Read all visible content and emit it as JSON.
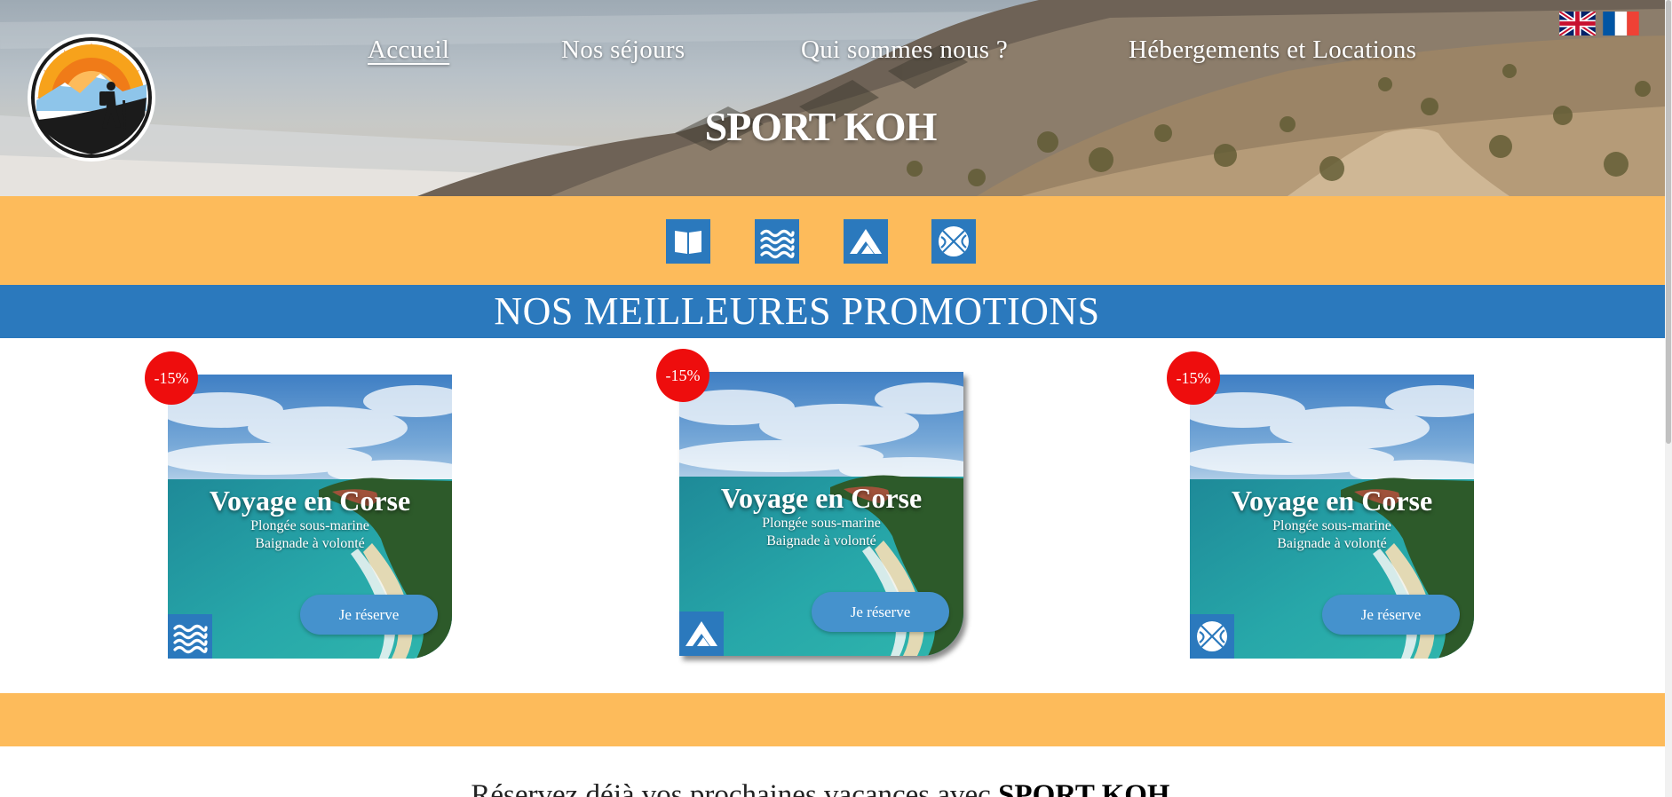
{
  "header": {
    "nav": [
      {
        "label": "Accueil",
        "active": true
      },
      {
        "label": "Nos séjours",
        "active": false
      },
      {
        "label": "Qui sommes nous ?",
        "active": false
      },
      {
        "label": "Hébergements et Locations",
        "active": false
      }
    ],
    "languages": [
      {
        "name": "uk-flag-icon",
        "code": "EN"
      },
      {
        "name": "france-flag-icon",
        "code": "FR"
      }
    ],
    "logo": "hiker-sunset-logo",
    "site_title": "SPORT KOH"
  },
  "categories": [
    {
      "icon": "book-icon"
    },
    {
      "icon": "waves-icon"
    },
    {
      "icon": "mountain-icon"
    },
    {
      "icon": "basketball-icon"
    }
  ],
  "promotions": {
    "title": "NOS MEILLEURES PROMOTIONS",
    "cards": [
      {
        "discount": "-15%",
        "title": "Voyage en Corse",
        "line1": "Plongée sous-marine",
        "line2": "Baignade à volonté",
        "button": "Je réserve",
        "category_icon": "waves-icon"
      },
      {
        "discount": "-15%",
        "title": "Voyage en Corse",
        "line1": "Plongée sous-marine",
        "line2": "Baignade à volonté",
        "button": "Je réserve",
        "category_icon": "mountain-icon"
      },
      {
        "discount": "-15%",
        "title": "Voyage en Corse",
        "line1": "Plongée sous-marine",
        "line2": "Baignade à volonté",
        "button": "Je réserve",
        "category_icon": "basketball-icon"
      }
    ]
  },
  "tagline": {
    "text": "Réservez déjà vos prochaines vacances avec ",
    "brand": "SPORT KOH"
  },
  "colors": {
    "orange": "#fdbb5b",
    "blue": "#2b79bd",
    "button_blue": "#4592cd",
    "discount_red": "#ee0d0d"
  }
}
